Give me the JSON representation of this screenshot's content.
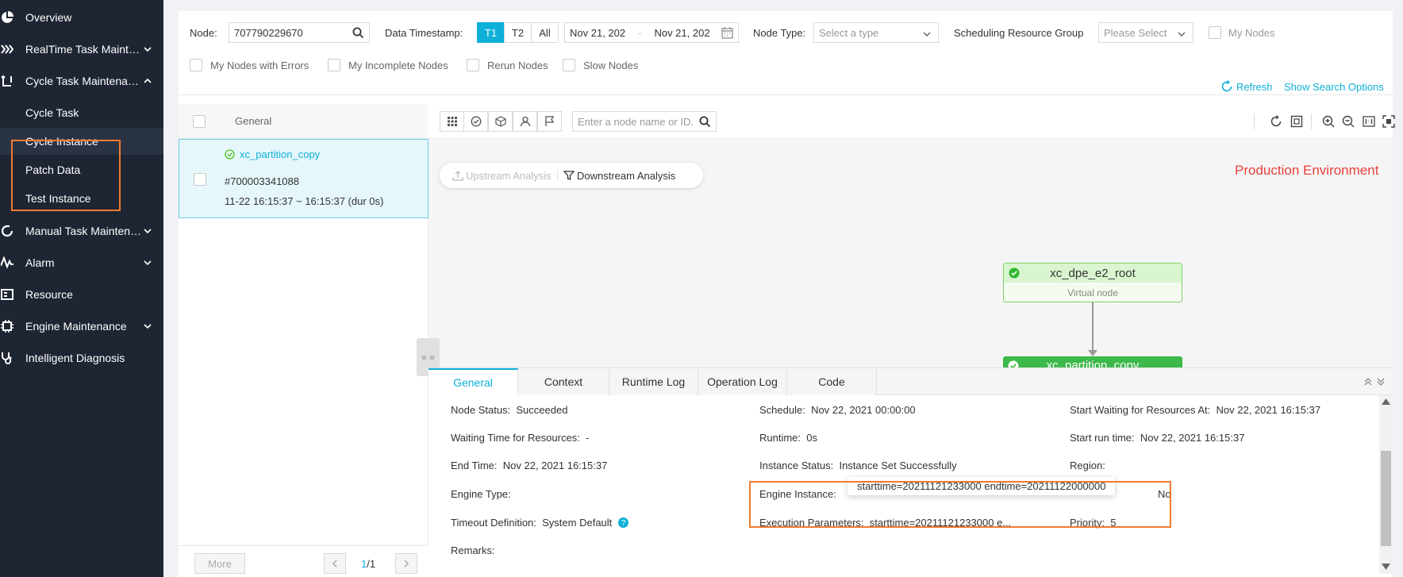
{
  "sidebar": {
    "items": [
      {
        "label": "Overview",
        "icon": "pie-chart-icon"
      },
      {
        "label": "RealTime Task Mainten...",
        "icon": "stream-icon"
      },
      {
        "label": "Cycle Task Maintenance",
        "icon": "cycle-icon"
      },
      {
        "label": "Manual Task Maintenan...",
        "icon": "refresh-icon"
      },
      {
        "label": "Alarm",
        "icon": "pulse-icon"
      },
      {
        "label": "Resource",
        "icon": "resource-icon"
      },
      {
        "label": "Engine Maintenance",
        "icon": "chip-icon"
      },
      {
        "label": "Intelligent Diagnosis",
        "icon": "stethoscope-icon"
      }
    ],
    "sub_items": [
      {
        "label": "Cycle Task"
      },
      {
        "label": "Cycle Instance"
      },
      {
        "label": "Patch Data"
      },
      {
        "label": "Test Instance"
      }
    ]
  },
  "filters": {
    "node_label": "Node:",
    "node_value": "707790229670",
    "data_timestamp_label": "Data Timestamp:",
    "t1": "T1",
    "t2": "T2",
    "all": "All",
    "date_start": "Nov 21, 202",
    "date_sep": "-",
    "date_end": "Nov 21, 202",
    "node_type_label": "Node Type:",
    "node_type_placeholder": "Select a type",
    "resource_group_label": "Scheduling Resource Group",
    "resource_group_placeholder": "Please Select",
    "my_nodes": "My Nodes",
    "nodes_with_errors": "My Nodes with Errors",
    "incomplete_nodes": "My Incomplete Nodes",
    "rerun_nodes": "Rerun Nodes",
    "slow_nodes": "Slow Nodes",
    "refresh": "Refresh",
    "show_search_options": "Show Search Options"
  },
  "list": {
    "header": "General",
    "instance": {
      "name": "xc_partition_copy",
      "id": "#700003341088",
      "time": "11-22 16:15:37 ~ 16:15:37 (dur 0s)"
    },
    "more": "More",
    "page_current": "1",
    "page_total": "/1"
  },
  "graph": {
    "search_placeholder": "Enter a node name or ID.",
    "upstream": "Upstream Analysis",
    "downstream": "Downstream Analysis",
    "environment": "Production Environment",
    "root_node": {
      "name": "xc_dpe_e2_root",
      "type": "Virtual node"
    },
    "child_node": {
      "name": "xc_partition_copy"
    }
  },
  "detail": {
    "tabs": [
      "General",
      "Context",
      "Runtime Log",
      "Operation Log",
      "Code"
    ],
    "node_status_label": "Node Status:",
    "node_status": "Succeeded",
    "schedule_label": "Schedule:",
    "schedule": "Nov 22, 2021 00:00:00",
    "start_waiting_label": "Start Waiting for Resources At:",
    "start_waiting": "Nov 22, 2021 16:15:37",
    "waiting_time_label": "Waiting Time for Resources:",
    "waiting_time": "-",
    "runtime_label": "Runtime:",
    "runtime": "0s",
    "start_run_label": "Start run time:",
    "start_run": "Nov 22, 2021 16:15:37",
    "end_time_label": "End Time:",
    "end_time": "Nov 22, 2021 16:15:37",
    "instance_status_label": "Instance Status:",
    "instance_status": "Instance Set Successfully",
    "region_label": "Region:",
    "engine_type_label": "Engine Type:",
    "engine_instance_label": "Engine Instance:",
    "tooltip": "starttime=20211121233000 endtime=20211122000000",
    "no_value": "No",
    "timeout_label": "Timeout Definition:",
    "timeout": "System Default",
    "exec_params_label": "Execution Parameters:",
    "exec_params": "starttime=20211121233000 e...",
    "priority_label": "Priority:",
    "priority": "5",
    "remarks_label": "Remarks:"
  },
  "colors": {
    "accent": "#0eb0d9",
    "highlight": "#ef7b2f",
    "environment": "#e9413b",
    "success": "#52c41a"
  }
}
